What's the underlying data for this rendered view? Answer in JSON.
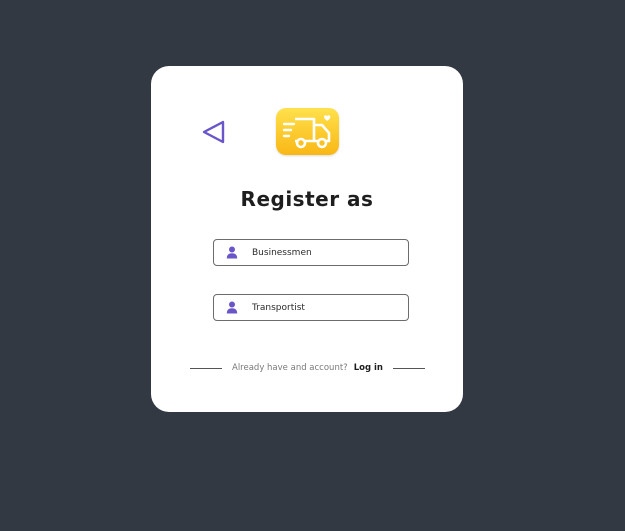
{
  "register": {
    "title": "Register as",
    "back_icon": "back-triangle-icon",
    "logo_icon": "delivery-truck-icon",
    "options": [
      {
        "label": "Businessmen",
        "icon": "person-icon"
      },
      {
        "label": "Transportist",
        "icon": "person-icon"
      }
    ],
    "footer": {
      "prompt": "Already have and account?",
      "login_label": "Log in"
    }
  },
  "colors": {
    "background": "#333943",
    "card": "#ffffff",
    "accent": "#6a56c9",
    "logo_top": "#ffe14d",
    "logo_bottom": "#f9b715"
  }
}
